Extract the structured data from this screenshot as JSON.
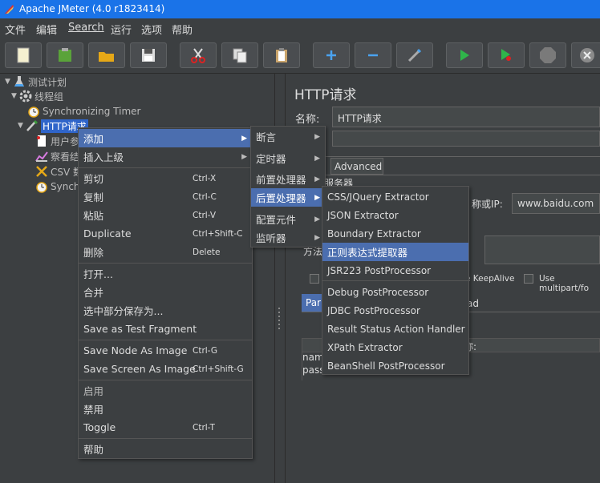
{
  "window": {
    "title": "Apache JMeter (4.0 r1823414)"
  },
  "menubar": [
    "文件",
    "编辑",
    "Search",
    "运行",
    "选项",
    "帮助"
  ],
  "toolbar": [
    "new-icon",
    "templates-icon",
    "open-icon",
    "save-icon",
    "cut-icon",
    "copy-icon",
    "paste-icon",
    "expand-icon",
    "collapse-icon",
    "toggle-icon",
    "start-icon",
    "start-no-pause-icon",
    "stop-icon",
    "shutdown-icon"
  ],
  "tree": {
    "items": [
      {
        "label": "测试计划"
      },
      {
        "label": "线程组"
      },
      {
        "label": "Synchronizing Timer"
      },
      {
        "label": "HTTP请求"
      },
      {
        "label": "用户参"
      },
      {
        "label": "察看结"
      },
      {
        "label": "CSV 数"
      },
      {
        "label": "Synch"
      }
    ]
  },
  "panel": {
    "title": "HTTP请求",
    "name_label": "名称:",
    "name_value": "HTTP请求",
    "tab_advanced": "Advanced",
    "server_group": "服务器",
    "ip_label": "称或IP:",
    "ip_value": "www.baidu.com",
    "method_label": "方法",
    "keepalive": "e KeepAlive",
    "multipart": "Use multipart/fo",
    "params_tab": "Par",
    "body_tab": "ad",
    "col_name": "称:",
    "row1": "nam",
    "row2": "pass"
  },
  "context_menu": {
    "items": [
      {
        "label": "添加",
        "sub": true
      },
      {
        "label": "插入上级",
        "sub": true
      },
      {
        "label": "剪切",
        "shortcut": "Ctrl-X"
      },
      {
        "label": "复制",
        "shortcut": "Ctrl-C"
      },
      {
        "label": "粘贴",
        "shortcut": "Ctrl-V"
      },
      {
        "label": "Duplicate",
        "shortcut": "Ctrl+Shift-C"
      },
      {
        "label": "删除",
        "shortcut": "Delete"
      },
      {
        "label": "打开..."
      },
      {
        "label": "合并"
      },
      {
        "label": "选中部分保存为..."
      },
      {
        "label": "Save as Test Fragment"
      },
      {
        "label": "Save Node As Image",
        "shortcut": "Ctrl-G"
      },
      {
        "label": "Save Screen As Image",
        "shortcut": "Ctrl+Shift-G"
      },
      {
        "label": "启用"
      },
      {
        "label": "禁用"
      },
      {
        "label": "Toggle",
        "shortcut": "Ctrl-T"
      },
      {
        "label": "帮助"
      }
    ]
  },
  "add_submenu": {
    "items": [
      "断言",
      "定时器",
      "前置处理器",
      "后置处理器",
      "配置元件",
      "监听器"
    ]
  },
  "post_processor_submenu": {
    "items": [
      "CSS/JQuery Extractor",
      "JSON Extractor",
      "Boundary Extractor",
      "正则表达式提取器",
      "JSR223 PostProcessor",
      "Debug PostProcessor",
      "JDBC PostProcessor",
      "Result Status Action Handler",
      "XPath Extractor",
      "BeanShell PostProcessor"
    ]
  },
  "colors": {
    "titlebar": "#1a73e8",
    "selection": "#2f65ca",
    "menu_active": "#4b6eaf",
    "bg": "#3c3f41"
  }
}
